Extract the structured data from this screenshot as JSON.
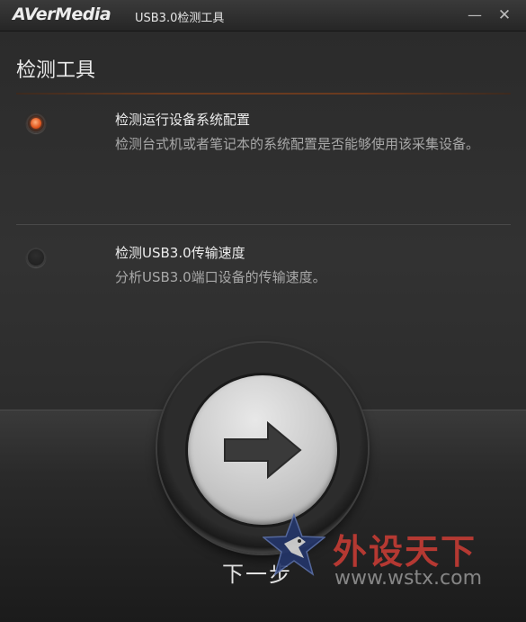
{
  "titlebar": {
    "logo": "AVerMedia",
    "title": "USB3.0检测工具",
    "minimize_glyph": "—",
    "close_glyph": "✕"
  },
  "header": {
    "title": "检测工具"
  },
  "options": [
    {
      "title": "检测运行设备系统配置",
      "description": "检测台式机或者笔记本的系统配置是否能够使用该采集设备。",
      "selected": true
    },
    {
      "title": "检测USB3.0传输速度",
      "description": "分析USB3.0端口设备的传输速度。",
      "selected": false
    }
  ],
  "footer": {
    "next_label": "下一步"
  },
  "watermark": {
    "text": "外设天下",
    "url": "www.wstx.com"
  },
  "colors": {
    "accent": "#e2561e",
    "background": "#2a2a2a",
    "watermark_red": "#c23b34"
  },
  "icons": {
    "next": "arrow-right-icon",
    "minimize": "minimize-icon",
    "close": "close-icon"
  }
}
